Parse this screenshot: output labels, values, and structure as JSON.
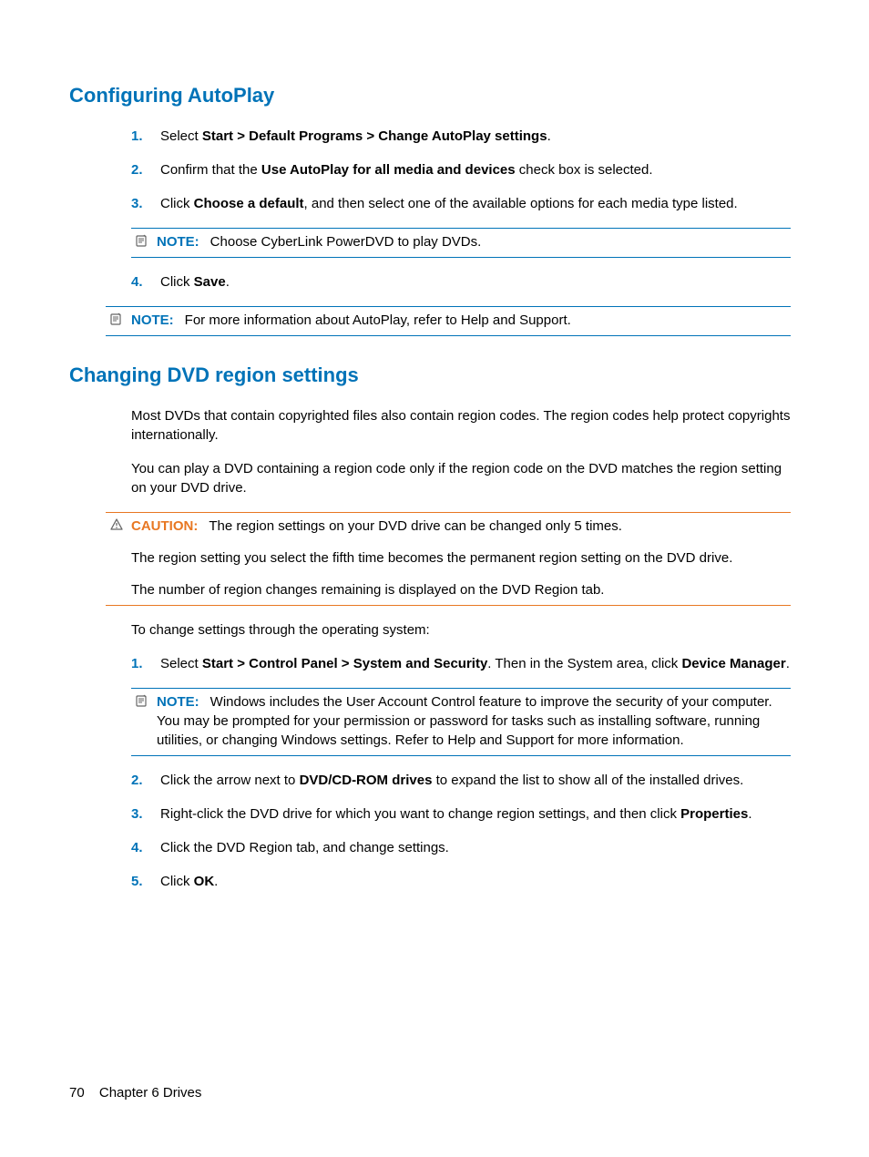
{
  "section1": {
    "heading": "Configuring AutoPlay",
    "steps": [
      {
        "num": "1.",
        "pre": "Select ",
        "bold": "Start > Default Programs > Change AutoPlay settings",
        "post": "."
      },
      {
        "num": "2.",
        "pre": "Confirm that the ",
        "bold": "Use AutoPlay for all media and devices",
        "post": " check box is selected."
      },
      {
        "num": "3.",
        "pre": "Click ",
        "bold": "Choose a default",
        "post": ", and then select one of the available options for each media type listed."
      }
    ],
    "note1": {
      "label": "NOTE:",
      "text": "Choose CyberLink PowerDVD to play DVDs."
    },
    "step4": {
      "num": "4.",
      "pre": "Click ",
      "bold": "Save",
      "post": "."
    },
    "note2": {
      "label": "NOTE:",
      "text": "For more information about AutoPlay, refer to Help and Support."
    }
  },
  "section2": {
    "heading": "Changing DVD region settings",
    "para1": "Most DVDs that contain copyrighted files also contain region codes. The region codes help protect copyrights internationally.",
    "para2": "You can play a DVD containing a region code only if the region code on the DVD matches the region setting on your DVD drive.",
    "caution": {
      "label": "CAUTION:",
      "line1": "The region settings on your DVD drive can be changed only 5 times.",
      "line2": "The region setting you select the fifth time becomes the permanent region setting on the DVD drive.",
      "line3": "The number of region changes remaining is displayed on the DVD Region tab."
    },
    "para3": "To change settings through the operating system:",
    "step1": {
      "num": "1.",
      "pre": "Select ",
      "bold1": "Start > Control Panel > System and Security",
      "mid": ". Then in the System area, click ",
      "bold2": "Device Manager",
      "post": "."
    },
    "note3": {
      "label": "NOTE:",
      "text": "Windows includes the User Account Control feature to improve the security of your computer. You may be prompted for your permission or password for tasks such as installing software, running utilities, or changing Windows settings. Refer to Help and Support for more information."
    },
    "step2": {
      "num": "2.",
      "pre": "Click the arrow next to ",
      "bold": "DVD/CD-ROM drives",
      "post": " to expand the list to show all of the installed drives."
    },
    "step3": {
      "num": "3.",
      "pre": "Right-click the DVD drive for which you want to change region settings, and then click ",
      "bold": "Properties",
      "post": "."
    },
    "step4": {
      "num": "4.",
      "text": "Click the DVD Region tab, and change settings."
    },
    "step5": {
      "num": "5.",
      "pre": "Click ",
      "bold": "OK",
      "post": "."
    }
  },
  "footer": {
    "page": "70",
    "chapter": "Chapter 6   Drives"
  }
}
